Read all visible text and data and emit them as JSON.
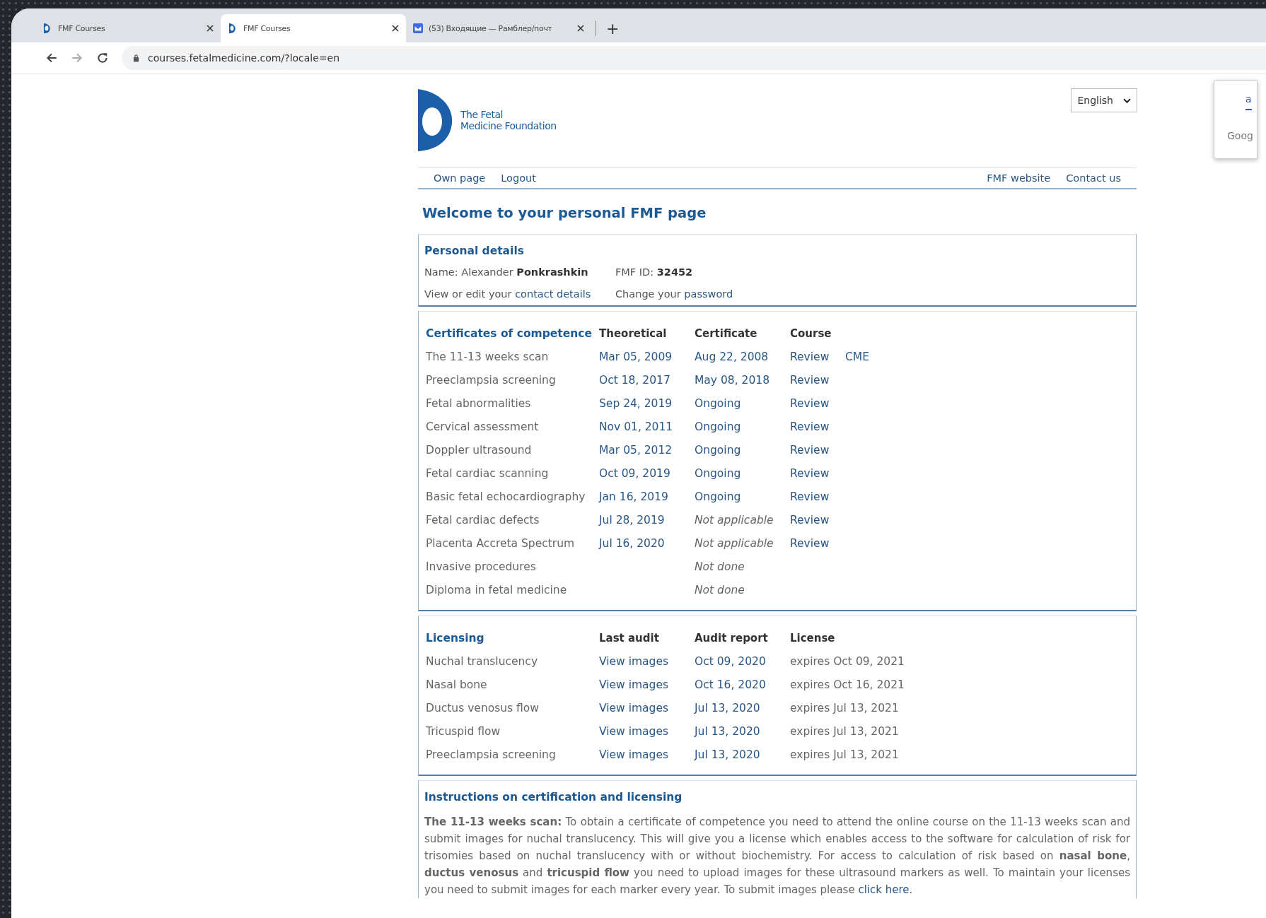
{
  "browser": {
    "tabs": [
      {
        "title": "FMF Courses",
        "kind": "site",
        "selected": false
      },
      {
        "title": "FMF Courses",
        "kind": "site",
        "selected": true
      },
      {
        "title": "(53) Входящие — Рамблер/почт",
        "kind": "mail",
        "selected": false
      }
    ],
    "new_tab": "+",
    "url": "courses.fetalmedicine.com/?locale=en"
  },
  "popup": {
    "tab": "a",
    "text": "Goog"
  },
  "header": {
    "logo_line1": "The Fetal",
    "logo_line2": "Medicine Foundation",
    "language": "English"
  },
  "nav": {
    "left": [
      "Own page",
      "Logout"
    ],
    "right": [
      "FMF website",
      "Contact us"
    ]
  },
  "welcome": "Welcome to your personal FMF page",
  "personal": {
    "title": "Personal details",
    "name_label": "Name: Alexander ",
    "name": "Ponkrashkin",
    "id_label": "FMF ID: ",
    "id": "32452",
    "edit_text": "View or edit your ",
    "edit_link": "contact details",
    "password_text": "Change your ",
    "password_link": "password"
  },
  "certificates": {
    "columns": [
      "Certificates of competence",
      "Theoretical",
      "Certificate",
      "Course"
    ],
    "rows": [
      [
        {
          "text": "The 11-13 weeks scan",
          "kind": "text"
        },
        {
          "text": "Mar 05, 2009",
          "kind": "link"
        },
        {
          "text": "Aug 22, 2008",
          "kind": "link"
        },
        {
          "text": "Review",
          "kind": "link"
        },
        {
          "text": "CME",
          "kind": "link"
        }
      ],
      [
        {
          "text": "Preeclampsia screening",
          "kind": "text"
        },
        {
          "text": "Oct 18, 2017",
          "kind": "link"
        },
        {
          "text": "May 08, 2018",
          "kind": "link"
        },
        {
          "text": "Review",
          "kind": "link"
        }
      ],
      [
        {
          "text": "Fetal abnormalities",
          "kind": "text"
        },
        {
          "text": "Sep 24, 2019",
          "kind": "link"
        },
        {
          "text": "Ongoing",
          "kind": "link"
        },
        {
          "text": "Review",
          "kind": "link"
        }
      ],
      [
        {
          "text": "Cervical assessment",
          "kind": "text"
        },
        {
          "text": "Nov 01, 2011",
          "kind": "link"
        },
        {
          "text": "Ongoing",
          "kind": "link"
        },
        {
          "text": "Review",
          "kind": "link"
        }
      ],
      [
        {
          "text": "Doppler ultrasound",
          "kind": "text"
        },
        {
          "text": "Mar 05, 2012",
          "kind": "link"
        },
        {
          "text": "Ongoing",
          "kind": "link"
        },
        {
          "text": "Review",
          "kind": "link"
        }
      ],
      [
        {
          "text": "Fetal cardiac scanning",
          "kind": "text"
        },
        {
          "text": "Oct 09, 2019",
          "kind": "link"
        },
        {
          "text": "Ongoing",
          "kind": "link"
        },
        {
          "text": "Review",
          "kind": "link"
        }
      ],
      [
        {
          "text": "Basic fetal echocardiography",
          "kind": "text"
        },
        {
          "text": "Jan 16, 2019",
          "kind": "link"
        },
        {
          "text": "Ongoing",
          "kind": "link"
        },
        {
          "text": "Review",
          "kind": "link"
        }
      ],
      [
        {
          "text": "Fetal cardiac defects",
          "kind": "text"
        },
        {
          "text": "Jul 28, 2019",
          "kind": "link"
        },
        {
          "text": "Not applicable",
          "kind": "italic"
        },
        {
          "text": "Review",
          "kind": "link"
        }
      ],
      [
        {
          "text": "Placenta Accreta Spectrum",
          "kind": "text"
        },
        {
          "text": "Jul 16, 2020",
          "kind": "link"
        },
        {
          "text": "Not applicable",
          "kind": "italic"
        },
        {
          "text": "Review",
          "kind": "link"
        }
      ],
      [
        {
          "text": "Invasive procedures",
          "kind": "text"
        },
        {
          "text": "",
          "kind": "empty"
        },
        {
          "text": "Not done",
          "kind": "italic"
        }
      ],
      [
        {
          "text": "Diploma in fetal medicine",
          "kind": "text"
        },
        {
          "text": "",
          "kind": "empty"
        },
        {
          "text": "Not done",
          "kind": "italic"
        }
      ]
    ]
  },
  "licensing": {
    "columns": [
      "Licensing",
      "Last audit",
      "Audit report",
      "License"
    ],
    "rows": [
      [
        {
          "text": "Nuchal translucency",
          "kind": "text"
        },
        {
          "text": "View images",
          "kind": "link"
        },
        {
          "text": "Oct 09, 2020",
          "kind": "link"
        },
        {
          "text": "expires Oct 09, 2021",
          "kind": "text"
        }
      ],
      [
        {
          "text": "Nasal bone",
          "kind": "text"
        },
        {
          "text": "View images",
          "kind": "link"
        },
        {
          "text": "Oct 16, 2020",
          "kind": "link"
        },
        {
          "text": "expires Oct 16, 2021",
          "kind": "text"
        }
      ],
      [
        {
          "text": "Ductus venosus flow",
          "kind": "text"
        },
        {
          "text": "View images",
          "kind": "link"
        },
        {
          "text": "Jul 13, 2020",
          "kind": "link"
        },
        {
          "text": "expires Jul 13, 2021",
          "kind": "text"
        }
      ],
      [
        {
          "text": "Tricuspid flow",
          "kind": "text"
        },
        {
          "text": "View images",
          "kind": "link"
        },
        {
          "text": "Jul 13, 2020",
          "kind": "link"
        },
        {
          "text": "expires Jul 13, 2021",
          "kind": "text"
        }
      ],
      [
        {
          "text": "Preeclampsia screening",
          "kind": "text"
        },
        {
          "text": "View images",
          "kind": "link"
        },
        {
          "text": "Jul 13, 2020",
          "kind": "link"
        },
        {
          "text": "expires Jul 13, 2021",
          "kind": "text"
        }
      ]
    ]
  },
  "instructions": {
    "title": "Instructions on certification and licensing",
    "text": "**The 11-13 weeks scan:** To obtain a certificate of competence you need to attend the online course on the 11-13 weeks scan and submit images for nuchal translucency. This will give you a license which enables access to the software for calculation of risk for trisomies based on nuchal translucency with or without biochemistry. For access to calculation of risk based on **nasal bone**, **ductus venosus** and **tricuspid flow** you need to upload images for these ultrasound markers as well. To maintain your licenses you need to submit images for each marker every year. To submit images please ",
    "link": "click here",
    "after": "."
  }
}
